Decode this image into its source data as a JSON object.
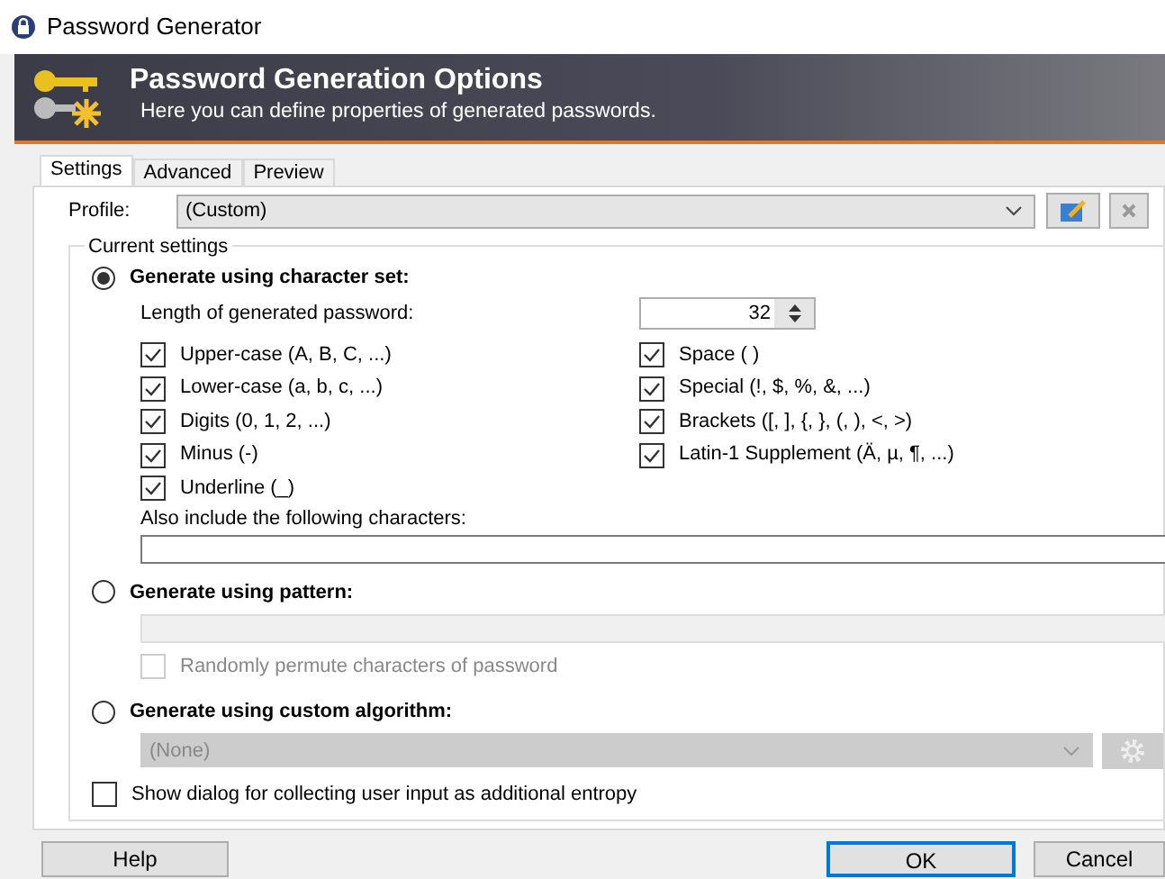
{
  "window": {
    "title": "Password Generator"
  },
  "header": {
    "title": "Password Generation Options",
    "subtitle": "Here you can define properties of generated passwords."
  },
  "tabs": [
    {
      "label": "Settings",
      "selected": true
    },
    {
      "label": "Advanced",
      "selected": false
    },
    {
      "label": "Preview",
      "selected": false
    }
  ],
  "profile": {
    "label": "Profile:",
    "value": "(Custom)"
  },
  "group": {
    "title": "Current settings"
  },
  "charset": {
    "label": "Generate using character set:",
    "selected": true,
    "length_label": "Length of generated password:",
    "length_value": "32",
    "left": [
      {
        "label": "Upper-case (A, B, C, ...)",
        "checked": true
      },
      {
        "label": "Lower-case (a, b, c, ...)",
        "checked": true
      },
      {
        "label": "Digits (0, 1, 2, ...)",
        "checked": true
      },
      {
        "label": "Minus (-)",
        "checked": true
      },
      {
        "label": "Underline (_)",
        "checked": true
      }
    ],
    "right": [
      {
        "label": "Space ( )",
        "checked": true
      },
      {
        "label": "Special (!, $, %, &, ...)",
        "checked": true
      },
      {
        "label": "Brackets ([, ], {, }, (, ), <, >)",
        "checked": true
      },
      {
        "label": "Latin-1 Supplement (Ä, µ, ¶, ...)",
        "checked": true
      }
    ],
    "also_label": "Also include the following characters:"
  },
  "pattern": {
    "label": "Generate using pattern:",
    "selected": false,
    "permute": {
      "label": "Randomly permute characters of password",
      "checked": false,
      "disabled": true
    }
  },
  "algorithm": {
    "label": "Generate using custom algorithm:",
    "selected": false,
    "value": "(None)",
    "disabled": true
  },
  "entropy": {
    "label": "Show dialog for collecting user input as additional entropy",
    "checked": false
  },
  "buttons": [
    {
      "label": "Help",
      "kind": "help"
    },
    {
      "label": "OK",
      "kind": "ok"
    },
    {
      "label": "Cancel",
      "kind": "cancel"
    }
  ]
}
